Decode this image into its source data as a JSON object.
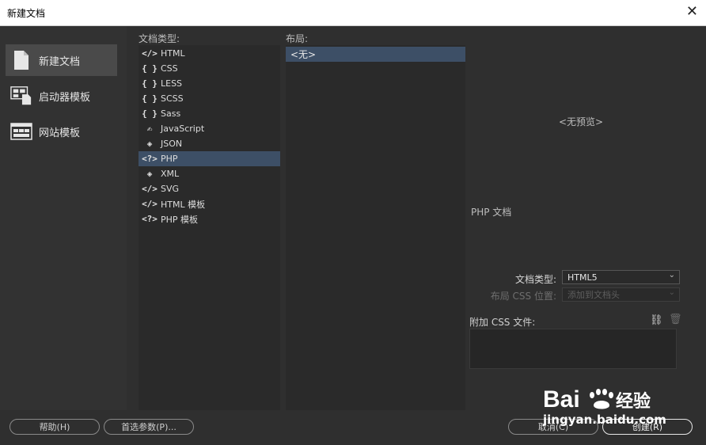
{
  "window": {
    "title": "新建文档"
  },
  "categories": [
    {
      "label": "新建文档",
      "icon": "new-document-icon",
      "selected": true
    },
    {
      "label": "启动器模板",
      "icon": "starter-template-icon",
      "selected": false
    },
    {
      "label": "网站模板",
      "icon": "site-template-icon",
      "selected": false
    }
  ],
  "doc_type_header": "文档类型:",
  "doc_types": [
    {
      "label": "HTML",
      "icon": "code-tag-icon",
      "glyph": "</>",
      "selected": false
    },
    {
      "label": "CSS",
      "icon": "braces-icon",
      "glyph": "{ }",
      "selected": false
    },
    {
      "label": "LESS",
      "icon": "braces-icon",
      "glyph": "{ }",
      "selected": false
    },
    {
      "label": "SCSS",
      "icon": "braces-icon",
      "glyph": "{ }",
      "selected": false
    },
    {
      "label": "Sass",
      "icon": "braces-icon",
      "glyph": "{ }",
      "selected": false
    },
    {
      "label": "JavaScript",
      "icon": "javascript-icon",
      "glyph": "✍",
      "selected": false
    },
    {
      "label": "JSON",
      "icon": "json-icon",
      "glyph": "◈",
      "selected": false
    },
    {
      "label": "PHP",
      "icon": "php-tag-icon",
      "glyph": "<?>",
      "selected": true
    },
    {
      "label": "XML",
      "icon": "xml-icon",
      "glyph": "◈",
      "selected": false
    },
    {
      "label": "SVG",
      "icon": "code-tag-icon",
      "glyph": "</>",
      "selected": false
    },
    {
      "label": "HTML 模板",
      "icon": "code-tag-icon",
      "glyph": "</>",
      "selected": false
    },
    {
      "label": "PHP 模板",
      "icon": "php-tag-icon",
      "glyph": "<?>",
      "selected": false
    }
  ],
  "layout_header": "布局:",
  "layouts": [
    {
      "label": "<无>",
      "selected": true
    }
  ],
  "preview": {
    "text": "<无预览>"
  },
  "description": "PHP 文档",
  "fields": {
    "doc_type_label": "文档类型:",
    "doc_type_value": "HTML5",
    "layout_css_label": "布局 CSS 位置:",
    "layout_css_value": "添加到文档头"
  },
  "attach_css_label": "附加 CSS 文件:",
  "buttons": {
    "help": "帮助(H)",
    "preferences": "首选参数(P)...",
    "cancel": "取消(C)",
    "create": "创建(R)"
  },
  "watermark": {
    "brand": "Bai 经验",
    "url": "jingyan.baidu.com"
  },
  "colors": {
    "background": "#2f2f2f",
    "selection": "#3d4f66",
    "list_bg": "#2a2a2a"
  }
}
